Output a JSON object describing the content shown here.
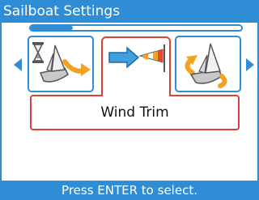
{
  "window": {
    "title": "Sailboat Settings"
  },
  "progress": {
    "value": 0.2
  },
  "carousel": {
    "items": [
      {
        "icon": "sailboat-timer-turn-icon",
        "selected": false
      },
      {
        "icon": "wind-trim-windsock-icon",
        "selected": true
      },
      {
        "icon": "sailboat-rotate-icon",
        "selected": false
      }
    ],
    "selected_label": "Wind Trim"
  },
  "status": {
    "text": "Press ENTER to select."
  },
  "colors": {
    "accent": "#2e8dd4",
    "selection": "#d94040",
    "arrow": "#f4a020"
  }
}
